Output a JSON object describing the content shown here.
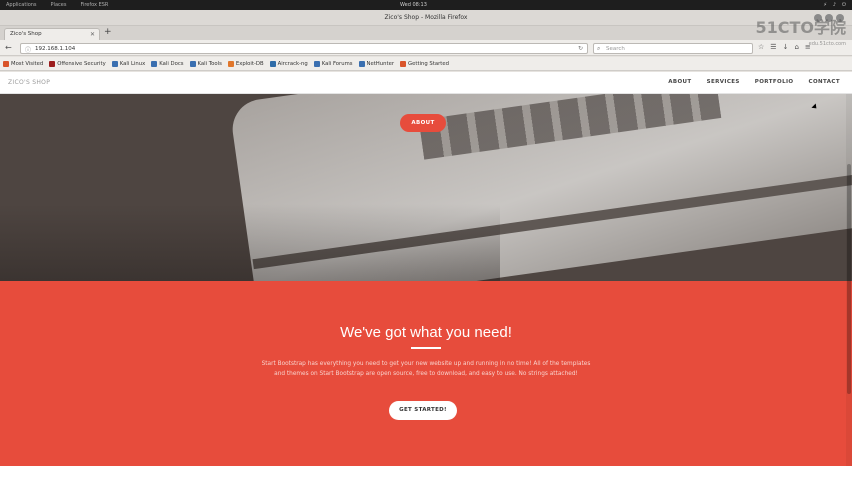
{
  "os_topbar": {
    "apps": "Applications",
    "places": "Places",
    "active_app": "Firefox ESR",
    "clock": "Wed 08:13"
  },
  "window": {
    "title": "Zico's Shop - Mozilla Firefox"
  },
  "tabs": [
    {
      "label": "Zico's Shop"
    }
  ],
  "navbar": {
    "url": "192.168.1.104",
    "search_placeholder": "Search"
  },
  "bookmarks": [
    {
      "label": "Most Visited",
      "color": "#d9542a"
    },
    {
      "label": "Offensive Security",
      "color": "#9b1c1c"
    },
    {
      "label": "Kali Linux",
      "color": "#3a6fb0"
    },
    {
      "label": "Kali Docs",
      "color": "#3a6fb0"
    },
    {
      "label": "Kali Tools",
      "color": "#3a6fb0"
    },
    {
      "label": "Exploit-DB",
      "color": "#e0762b"
    },
    {
      "label": "Aircrack-ng",
      "color": "#2f6ca8"
    },
    {
      "label": "Kali Forums",
      "color": "#3a6fb0"
    },
    {
      "label": "NetHunter",
      "color": "#3a6fb0"
    },
    {
      "label": "Getting Started",
      "color": "#d9542a"
    }
  ],
  "site": {
    "brand": "ZICO'S SHOP",
    "nav": [
      "ABOUT",
      "SERVICES",
      "PORTFOLIO",
      "CONTACT"
    ],
    "hero_button": "ABOUT",
    "cta_heading": "We've got what you need!",
    "cta_text": "Start Bootstrap has everything you need to get your new website up and running in no time! All of the templates and themes on Start Bootstrap are open source, free to download, and easy to use. No strings attached!",
    "cta_button": "GET STARTED!"
  },
  "watermark": {
    "text": "51CTO学院",
    "sub": "edu.51cto.com"
  },
  "colors": {
    "accent": "#e74c3c",
    "hero_bg": "#4e4541"
  }
}
